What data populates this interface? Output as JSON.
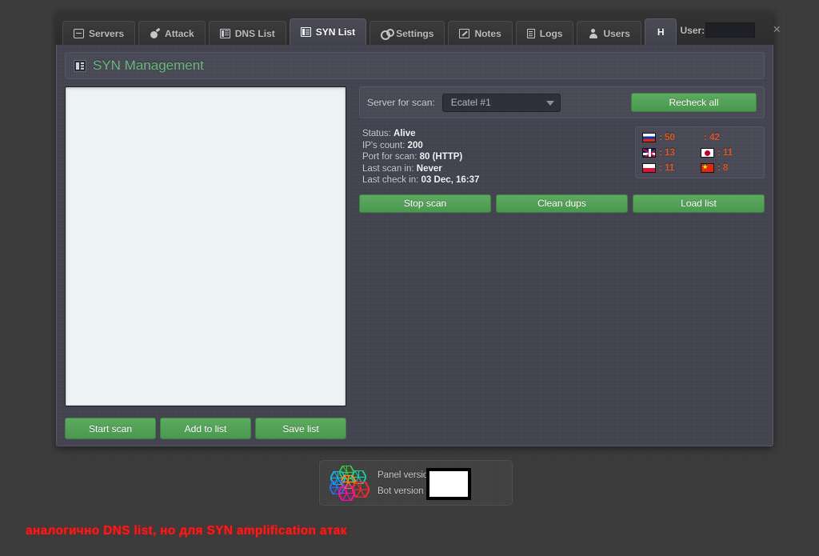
{
  "window": {
    "user_label": "User:",
    "user_value": "",
    "close_label": "×"
  },
  "tabs": [
    {
      "label": "Servers",
      "icon": "servers-icon",
      "active": false
    },
    {
      "label": "Attack",
      "icon": "bomb-icon",
      "active": false
    },
    {
      "label": "DNS List",
      "icon": "list-icon",
      "active": false
    },
    {
      "label": "SYN List",
      "icon": "list-icon",
      "active": true
    },
    {
      "label": "Settings",
      "icon": "gears-icon",
      "active": false
    },
    {
      "label": "Notes",
      "icon": "notes-icon",
      "active": false
    },
    {
      "label": "Logs",
      "icon": "document-icon",
      "active": false
    },
    {
      "label": "Users",
      "icon": "user-icon",
      "active": false
    },
    {
      "label": "H",
      "icon": "none",
      "active": true
    }
  ],
  "page": {
    "title": "SYN Management"
  },
  "list_panel": {
    "textarea_value": "",
    "textarea_placeholder": "",
    "buttons": [
      {
        "label": "Start scan"
      },
      {
        "label": "Add to list"
      },
      {
        "label": "Save list"
      }
    ]
  },
  "scan_row": {
    "server_label": "Server for scan:",
    "selected_server": "Ecatel #1",
    "server_options": [
      "Ecatel #1"
    ],
    "recheck_label": "Recheck all"
  },
  "status": {
    "rows": [
      {
        "label": "Status:",
        "value": "Alive"
      },
      {
        "label": "IP's count:",
        "value": "200"
      },
      {
        "label": "Port for scan:",
        "value": "80 (HTTP)"
      },
      {
        "label": "Last scan in:",
        "value": "Never"
      },
      {
        "label": "Last check in:",
        "value": "03 Dec, 16:37"
      }
    ]
  },
  "flags": [
    {
      "country": "ru",
      "name": "russia-flag",
      "count": ": 50"
    },
    {
      "country": "missing",
      "name": "missing-flag",
      "count": ": 42"
    },
    {
      "country": "gb",
      "name": "united-kingdom-flag",
      "count": ": 13"
    },
    {
      "country": "jp",
      "name": "japan-flag",
      "count": ": 11"
    },
    {
      "country": "pl",
      "name": "poland-flag",
      "count": ": 11"
    },
    {
      "country": "cn",
      "name": "china-flag",
      "count": ": 8"
    }
  ],
  "mid_buttons": [
    {
      "label": "Stop scan"
    },
    {
      "label": "Clean dups"
    },
    {
      "label": "Load list"
    }
  ],
  "footer": {
    "panel_version_label": "Panel version",
    "bot_version_label": "Bot version",
    "panel_version_value": "",
    "bot_version_value": ""
  },
  "annotation": {
    "text": "аналогично DNS list, но для SYN amplification атак"
  },
  "colors": {
    "accent_green": "#4b9750",
    "title_green": "#6cb97a",
    "flag_count_orange": "#d95a28",
    "annotation_red": "#ff1a1a",
    "panel_bg": "#434450",
    "window_bg": "#2e2e2e",
    "page_bg": "#3b3b3b"
  }
}
